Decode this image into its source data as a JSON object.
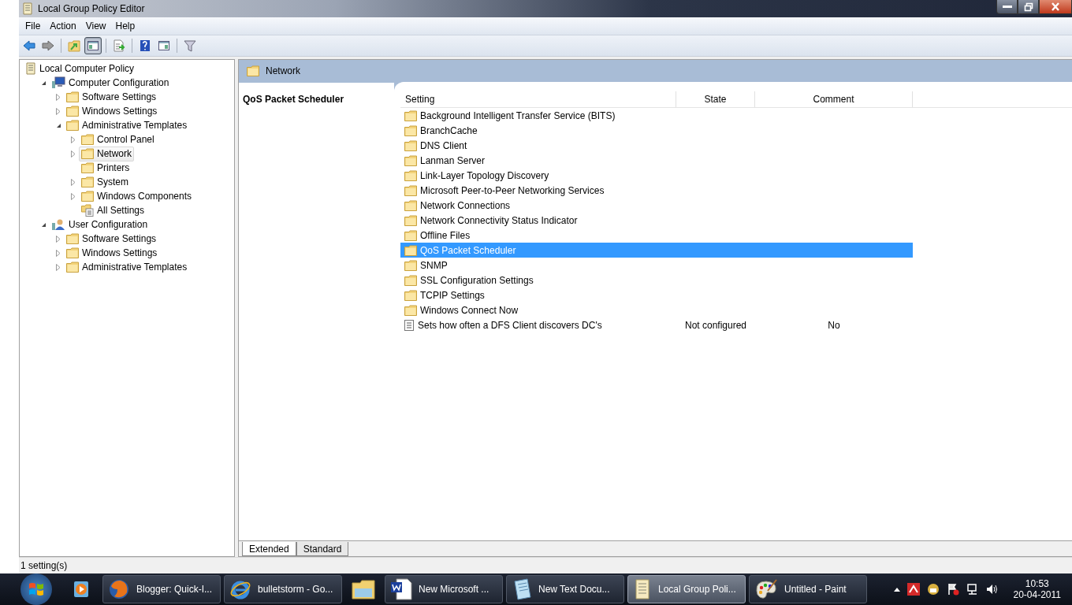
{
  "window": {
    "title": "Local Group Policy Editor"
  },
  "menu": [
    "File",
    "Action",
    "View",
    "Help"
  ],
  "toolbar": [
    [
      {
        "kind": "back",
        "selected": false
      },
      {
        "kind": "forward",
        "selected": false
      }
    ],
    [
      {
        "kind": "up",
        "selected": false
      },
      {
        "kind": "tree",
        "selected": true
      }
    ],
    [
      {
        "kind": "export",
        "selected": false
      }
    ],
    [
      {
        "kind": "help",
        "selected": false
      },
      {
        "kind": "pane",
        "selected": false
      }
    ],
    [
      {
        "kind": "filter",
        "selected": false
      }
    ]
  ],
  "tree": [
    {
      "label": "Local Computer Policy",
      "kind": "policy",
      "selected": false,
      "children": [
        {
          "label": "Computer Configuration",
          "kind": "computer",
          "expanded": true,
          "selected": false,
          "children": [
            {
              "label": "Software Settings",
              "kind": "folder",
              "expanded": false,
              "selected": false
            },
            {
              "label": "Windows Settings",
              "kind": "folder",
              "expanded": false,
              "selected": false
            },
            {
              "label": "Administrative Templates",
              "kind": "folder",
              "expanded": true,
              "selected": false,
              "children": [
                {
                  "label": "Control Panel",
                  "kind": "folder",
                  "expanded": false,
                  "selected": false
                },
                {
                  "label": "Network",
                  "kind": "folder",
                  "expanded": false,
                  "selected": true
                },
                {
                  "label": "Printers",
                  "kind": "folder",
                  "selected": false
                },
                {
                  "label": "System",
                  "kind": "folder",
                  "expanded": false,
                  "selected": false
                },
                {
                  "label": "Windows Components",
                  "kind": "folder",
                  "expanded": false,
                  "selected": false
                },
                {
                  "label": "All Settings",
                  "kind": "allsettings",
                  "selected": false
                }
              ]
            }
          ]
        },
        {
          "label": "User Configuration",
          "kind": "user",
          "expanded": true,
          "selected": false,
          "children": [
            {
              "label": "Software Settings",
              "kind": "folder",
              "expanded": false,
              "selected": false
            },
            {
              "label": "Windows Settings",
              "kind": "folder",
              "expanded": false,
              "selected": false
            },
            {
              "label": "Administrative Templates",
              "kind": "folder",
              "expanded": false,
              "selected": false
            }
          ]
        }
      ]
    }
  ],
  "pane_header": {
    "title": "Network"
  },
  "description": {
    "title": "QoS Packet Scheduler"
  },
  "table": {
    "columns": [
      "Setting",
      "State",
      "Comment"
    ],
    "rows": [
      {
        "kind": "folder",
        "setting": "Background Intelligent Transfer Service (BITS)",
        "selected": false
      },
      {
        "kind": "folder",
        "setting": "BranchCache",
        "selected": false
      },
      {
        "kind": "folder",
        "setting": "DNS Client",
        "selected": false
      },
      {
        "kind": "folder",
        "setting": "Lanman Server",
        "selected": false
      },
      {
        "kind": "folder",
        "setting": "Link-Layer Topology Discovery",
        "selected": false
      },
      {
        "kind": "folder",
        "setting": "Microsoft Peer-to-Peer Networking Services",
        "selected": false
      },
      {
        "kind": "folder",
        "setting": "Network Connections",
        "selected": false
      },
      {
        "kind": "folder",
        "setting": "Network Connectivity Status Indicator",
        "selected": false
      },
      {
        "kind": "folder",
        "setting": "Offline Files",
        "selected": false
      },
      {
        "kind": "folder",
        "setting": "QoS Packet Scheduler",
        "selected": true
      },
      {
        "kind": "folder",
        "setting": "SNMP",
        "selected": false
      },
      {
        "kind": "folder",
        "setting": "SSL Configuration Settings",
        "selected": false
      },
      {
        "kind": "folder",
        "setting": "TCPIP Settings",
        "selected": false
      },
      {
        "kind": "folder",
        "setting": "Windows Connect Now",
        "selected": false
      },
      {
        "kind": "setting",
        "setting": "Sets how often a DFS Client discovers DC's",
        "state": "Not configured",
        "comment": "No",
        "selected": false
      }
    ]
  },
  "tabs": [
    {
      "label": "Extended",
      "selected": true
    },
    {
      "label": "Standard",
      "selected": false
    }
  ],
  "status_bar": {
    "text": "1 setting(s)"
  },
  "taskbar": {
    "items": [
      {
        "kind": "media",
        "selected": false
      },
      {
        "kind": "firefox",
        "label": "Blogger: Quick-I...",
        "selected": false
      },
      {
        "kind": "ie",
        "label": "bulletstorm - Go...",
        "selected": false
      },
      {
        "kind": "explorer",
        "selected": false
      },
      {
        "kind": "word",
        "label": "New Microsoft ...",
        "selected": false
      },
      {
        "kind": "notepad",
        "label": "New Text Docu...",
        "selected": false
      },
      {
        "kind": "gpedit",
        "label": "Local Group Poli...",
        "selected": true
      },
      {
        "kind": "paint",
        "label": "Untitled - Paint",
        "selected": false
      }
    ],
    "time": "10:53",
    "date": "20-04-2011"
  }
}
